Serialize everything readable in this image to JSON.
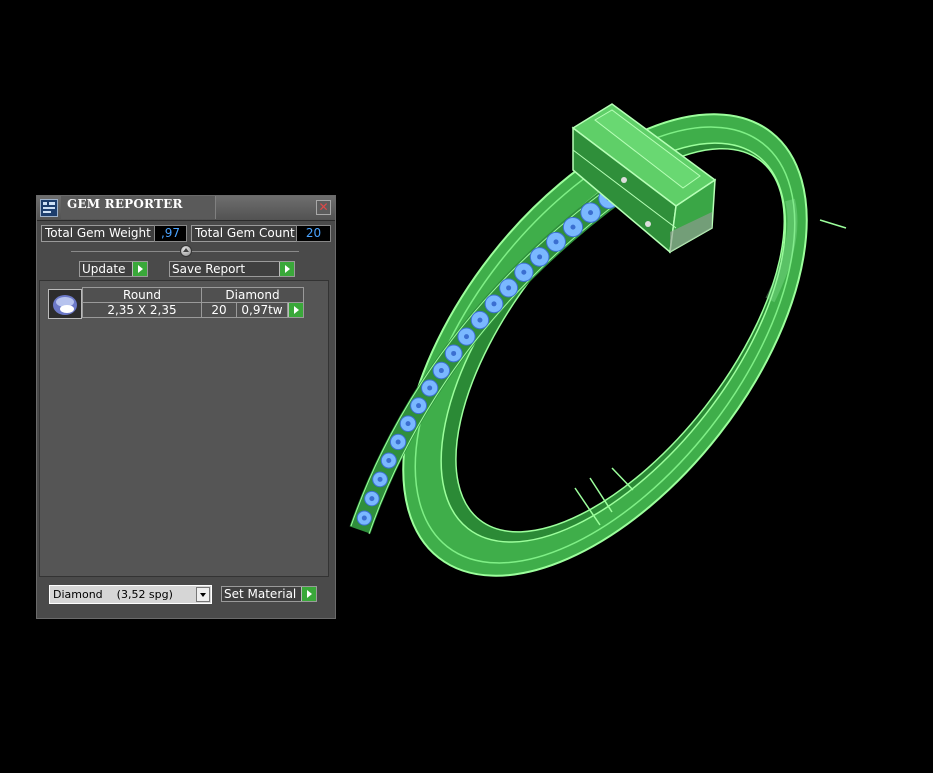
{
  "panel": {
    "title": "GEM REPORTER",
    "close_symbol": "✕",
    "total_weight_label": "Total Gem Weight",
    "total_weight_value": ",97",
    "total_count_label": "Total Gem Count",
    "total_count_value": "20",
    "update_label": "Update",
    "save_report_label": "Save Report",
    "gem_table": {
      "shape_header": "Round",
      "material_header": "Diamond",
      "size": "2,35 X 2,35",
      "count": "20",
      "weight": "0,97tw"
    },
    "material_select_value": "Diamond    (3,52 spg)",
    "set_material_label": "Set Material"
  },
  "icons": [
    "app-icon",
    "close-icon",
    "slider-thumb-icon",
    "gem-thumbnail-icon",
    "dropdown-arrow-icon",
    "play-arrow-icon"
  ],
  "colors": {
    "viewport_background": "#000000",
    "model_green": "#4fc45a",
    "model_edges": "#9cff9c",
    "gems": "#7ab8ff",
    "panel_background": "#4a4a4a",
    "value_text": "#4aa3ff",
    "action_arrow": "#3aa83a"
  }
}
